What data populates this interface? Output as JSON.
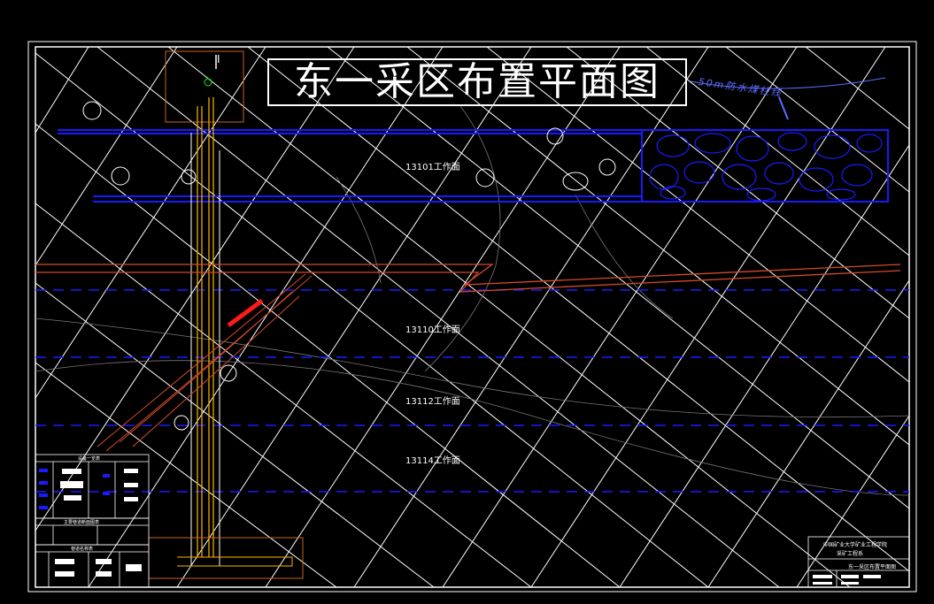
{
  "title": "东一采区布置平面图",
  "river_label": "50m防水煤柱线",
  "faces": [
    {
      "id": "f1",
      "label": "13101工作面"
    },
    {
      "id": "f2",
      "label": "13110工作面"
    },
    {
      "id": "f3",
      "label": "13112工作面"
    },
    {
      "id": "f4",
      "label": "13114工作面"
    }
  ],
  "shaft_label": "I",
  "legend": {
    "table1_title": "设备一览表",
    "table2_title": "主要巷道断面图表",
    "table3_title": "巷道名称表"
  },
  "title_block": {
    "school": "中国矿业大学矿业工程学院",
    "dept": "采矿工程系",
    "drawing": "东一采区布置平面图"
  },
  "colors": {
    "background": "#000000",
    "frame": "#ffffff",
    "roadway": "#1a1aff",
    "shaft": "#ffb400",
    "fault": "#d24a2a",
    "grid": "#ffffff"
  }
}
